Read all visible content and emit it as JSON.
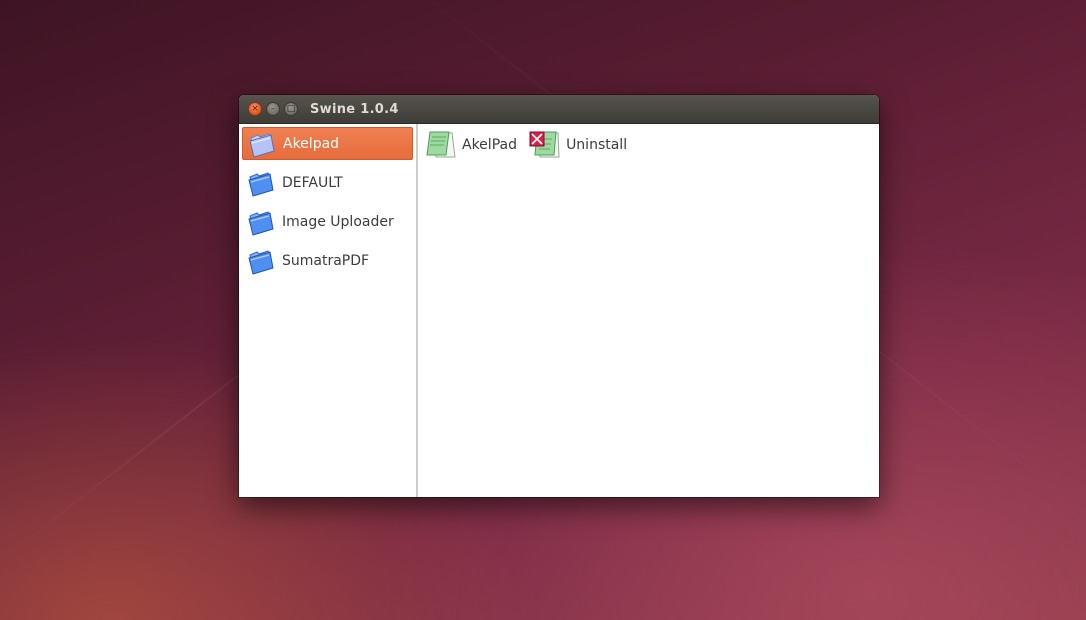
{
  "window": {
    "title": "Swine 1.0.4",
    "buttons": {
      "close": "×",
      "minimize": "–",
      "maximize": "□"
    }
  },
  "sidebar": {
    "items": [
      {
        "label": "Akelpad",
        "icon": "folder-icon",
        "selected": true
      },
      {
        "label": "DEFAULT",
        "icon": "folder-icon",
        "selected": false
      },
      {
        "label": "Image Uploader",
        "icon": "folder-icon",
        "selected": false
      },
      {
        "label": "SumatraPDF",
        "icon": "folder-icon",
        "selected": false
      }
    ]
  },
  "main": {
    "items": [
      {
        "label": "AkelPad",
        "icon": "notepad-icon"
      },
      {
        "label": "Uninstall",
        "icon": "uninstall-icon"
      }
    ]
  },
  "colors": {
    "selection": "#e66c3c",
    "titlebar": "#3e3c37"
  }
}
